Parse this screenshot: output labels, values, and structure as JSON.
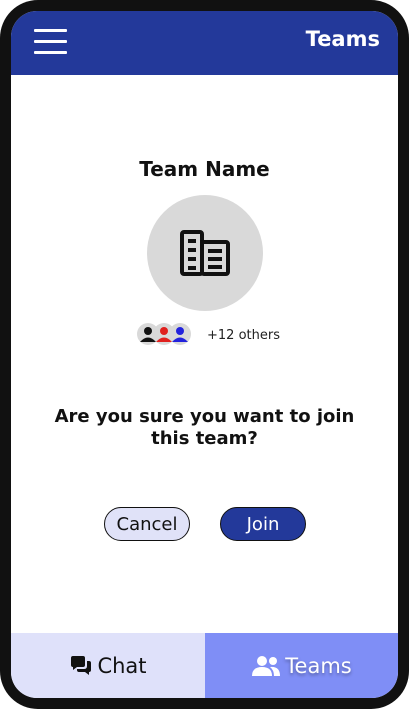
{
  "header": {
    "title": "Teams",
    "menu_icon": "hamburger-menu-icon"
  },
  "team": {
    "name": "Team Name",
    "avatar_icon": "building-icon",
    "member_icons": [
      "person-icon",
      "person-icon",
      "person-icon"
    ],
    "member_colors": [
      "#111111",
      "#e0201e",
      "#2222dd"
    ],
    "others_text": "+12 others"
  },
  "dialog": {
    "question": "Are you sure you want to join this team?",
    "cancel_label": "Cancel",
    "join_label": "Join"
  },
  "tabs": [
    {
      "label": "Chat",
      "icon": "chat-bubbles-icon",
      "active": false
    },
    {
      "label": "Teams",
      "icon": "people-icon",
      "active": true
    }
  ],
  "colors": {
    "brand": "#23399a",
    "active_tab": "#7f8ef6",
    "inactive_tab": "#dfe1fa",
    "cancel_bg": "#e0e2f8",
    "avatar_bg": "#d9d9d9"
  }
}
